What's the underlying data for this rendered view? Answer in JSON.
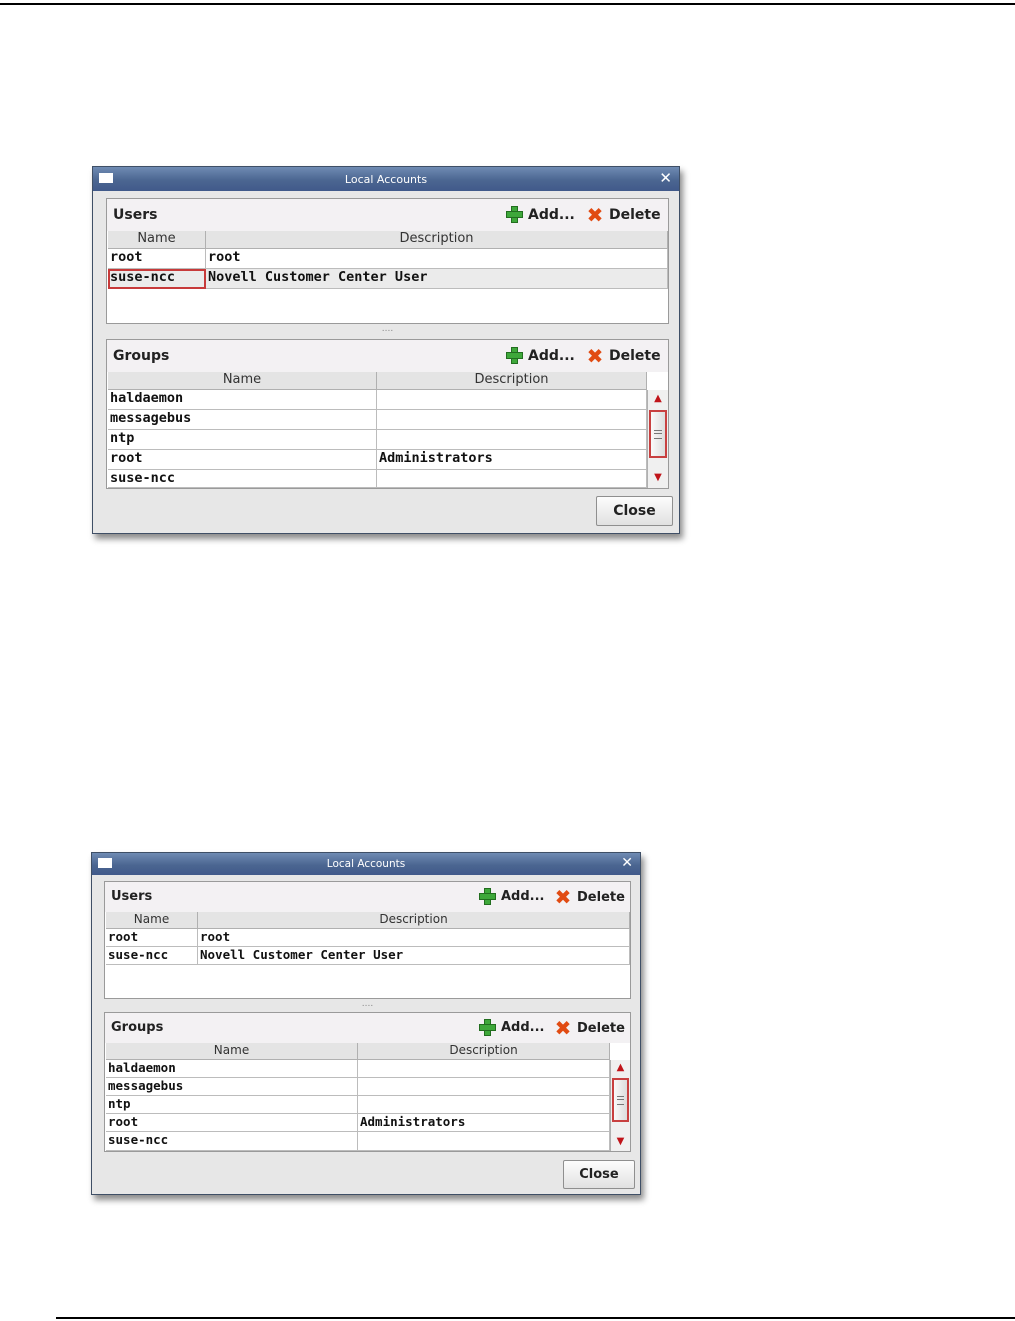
{
  "dialogs": [
    {
      "title": "Local Accounts",
      "users": {
        "title": "Users",
        "add_label": "Add...",
        "delete_label": "Delete",
        "columns": [
          "Name",
          "Description"
        ],
        "rows": [
          {
            "name": "root",
            "description": "root"
          },
          {
            "name": "suse-ncc",
            "description": "Novell Customer Center User"
          }
        ]
      },
      "splitter_label": "....",
      "groups": {
        "title": "Groups",
        "add_label": "Add...",
        "delete_label": "Delete",
        "columns": [
          "Name",
          "Description"
        ],
        "rows": [
          {
            "name": "haldaemon",
            "description": ""
          },
          {
            "name": "messagebus",
            "description": ""
          },
          {
            "name": "ntp",
            "description": ""
          },
          {
            "name": "root",
            "description": "Administrators"
          },
          {
            "name": "suse-ncc",
            "description": ""
          }
        ]
      },
      "close_label": "Close"
    },
    {
      "title": "Local Accounts",
      "users": {
        "title": "Users",
        "add_label": "Add...",
        "delete_label": "Delete",
        "columns": [
          "Name",
          "Description"
        ],
        "rows": [
          {
            "name": "root",
            "description": "root"
          },
          {
            "name": "suse-ncc",
            "description": "Novell Customer Center User"
          }
        ]
      },
      "splitter_label": "....",
      "groups": {
        "title": "Groups",
        "add_label": "Add...",
        "delete_label": "Delete",
        "columns": [
          "Name",
          "Description"
        ],
        "rows": [
          {
            "name": "haldaemon",
            "description": ""
          },
          {
            "name": "messagebus",
            "description": ""
          },
          {
            "name": "ntp",
            "description": ""
          },
          {
            "name": "root",
            "description": "Administrators"
          },
          {
            "name": "suse-ncc",
            "description": ""
          }
        ]
      },
      "close_label": "Close"
    }
  ]
}
